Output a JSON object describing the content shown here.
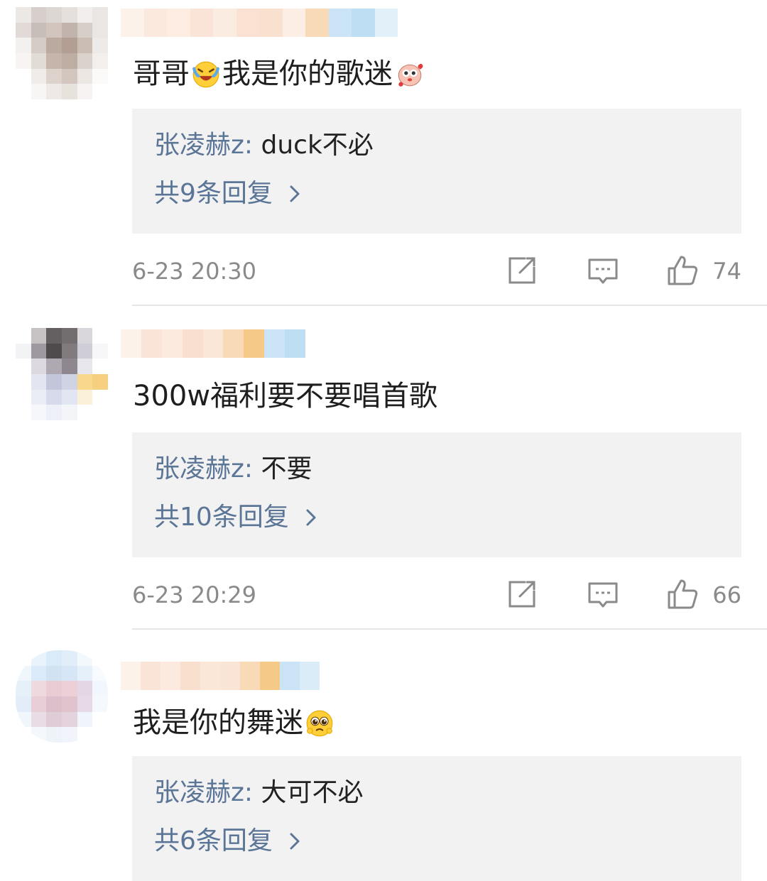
{
  "comments": [
    {
      "text_a": "哥哥",
      "emoji_a": "laughing-crying-emoji",
      "text_b": "我是你的歌迷",
      "emoji_b": "cute-creature-emoji",
      "reply_author": "张凌赫z:",
      "reply_text": "duck不必",
      "reply_count": "共9条回复",
      "time": "6-23 20:30",
      "likes": "74"
    },
    {
      "text_a": "300w福利要不要唱首歌",
      "reply_author": "张凌赫z:",
      "reply_text": "不要",
      "reply_count": "共10条回复",
      "time": "6-23 20:29",
      "likes": "66"
    },
    {
      "text_a": "我是你的舞迷",
      "emoji_a": "pleading-face-emoji",
      "reply_author": "张凌赫z:",
      "reply_text": "大可不必",
      "reply_count": "共6条回复"
    }
  ],
  "colors": {
    "reply_link": "#5b7596",
    "reply_bg": "#f2f2f2",
    "meta_text": "#8a8a8a",
    "icon_stroke": "#8a8a8a"
  }
}
